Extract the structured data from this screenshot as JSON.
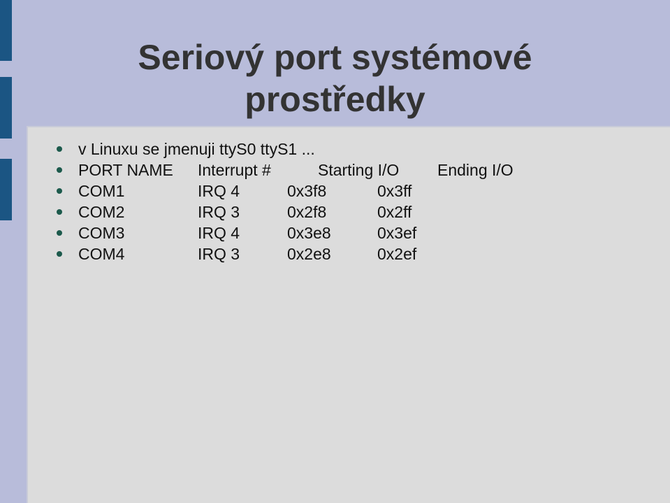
{
  "slide": {
    "title_line1": "Seriový port systémové",
    "title_line2": "prostředky",
    "intro": "v Linuxu se jmenuji ttyS0 ttyS1 ...",
    "table": {
      "headers": [
        "PORT NAME",
        "Interrupt #",
        "Starting I/O",
        "Ending I/O"
      ],
      "rows": [
        [
          "COM1",
          "IRQ 4",
          "0x3f8",
          "0x3ff"
        ],
        [
          "COM2",
          "IRQ 3",
          "0x2f8",
          "0x2ff"
        ],
        [
          "COM3",
          "IRQ 4",
          "0x3e8",
          "0x3ef"
        ],
        [
          "COM4",
          "IRQ 3",
          "0x2e8",
          "0x2ef"
        ]
      ]
    },
    "colors": {
      "background": "#b8bcda",
      "panel": "#dcdcdc",
      "accent_bar": "#1b5583",
      "bullet": "#1c5a4c",
      "title": "#333333"
    }
  }
}
